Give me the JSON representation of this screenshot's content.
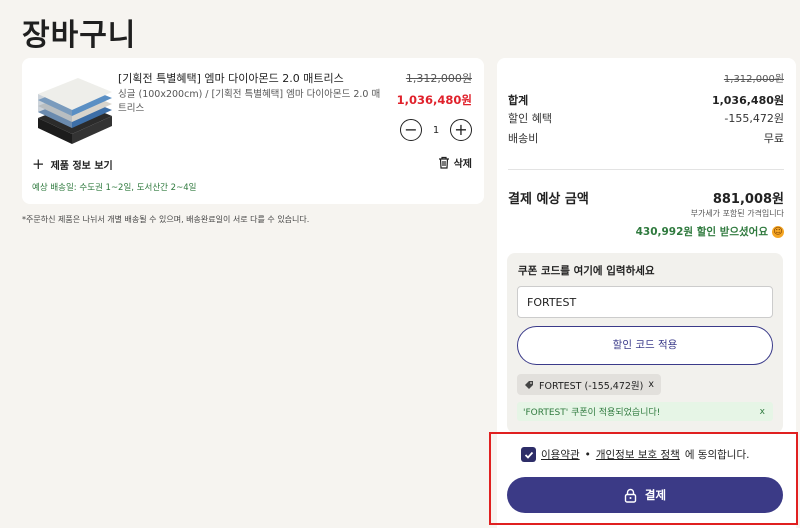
{
  "page": {
    "title": "장바구니"
  },
  "cart": {
    "item": {
      "name": "[기획전 특별혜택] 엠마 다이아몬드 2.0 매트리스",
      "option": "싱글 (100x200cm) / [기획전 특별혜택] 엠마 다이아몬드 2.0 매트리스",
      "original_price": "1,312,000원",
      "sale_price": "1,036,480원",
      "quantity": "1",
      "decrease_icon": "minus-circle-icon",
      "increase_icon": "plus-circle-icon",
      "info_label": "제품 정보 보기",
      "delete_label": "삭제",
      "delivery": "예상 배송일: 수도권 1~2일, 도서산간 2~4일"
    },
    "notice": "*주문하신 제품은 나뉘서 개별 배송될 수 있으며, 배송완료일이 서로 다를 수 있습니다."
  },
  "summary": {
    "original_total": "1,312,000원",
    "rows": [
      {
        "label": "합계",
        "value": "1,036,480원"
      },
      {
        "label": "할인 혜택",
        "value": "-155,472원"
      },
      {
        "label": "배송비",
        "value": "무료"
      }
    ],
    "total_label": "결제 예상 금액",
    "total_value": "881,008원",
    "vat_note": "부가세가 포함된 가격입니다",
    "saving_text": "430,992원 할인 받으셨어요"
  },
  "coupon": {
    "title": "쿠폰 코드를 여기에 입력하세요",
    "input_value": "FORTEST",
    "apply_label": "할인 코드 적용",
    "chip_label": "FORTEST (-155,472원)",
    "chip_remove": "x",
    "success_message": "'FORTEST' 쿠폰이 적용되었습니다!",
    "success_close": "x"
  },
  "agreement": {
    "terms": "이용약관",
    "separator": "•",
    "privacy": "개인정보 보호 정책",
    "suffix": "에 동의합니다.",
    "checked": true
  },
  "checkout": {
    "label": "결제",
    "icon": "lock-icon"
  },
  "colors": {
    "accent": "#3b3a86",
    "price_red": "#e0212b",
    "success_green": "#2f7a3e",
    "highlight": "#e02020"
  }
}
